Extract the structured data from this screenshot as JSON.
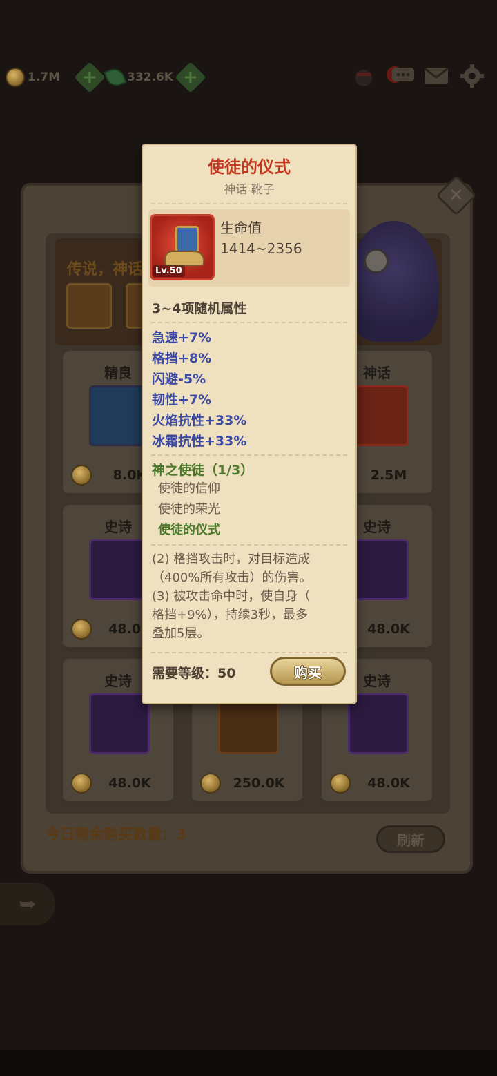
{
  "top_bar": {
    "gold": "1.7M",
    "gems": "332.6K",
    "notification_badge": "!"
  },
  "shop": {
    "banner_text": "传说，神话",
    "cards": [
      {
        "tier": "精良",
        "price": "8.0K"
      },
      {
        "tier": "神话",
        "price": "2.5M"
      },
      {
        "tier": "史诗",
        "price": "48.0K"
      },
      {
        "tier": "史诗",
        "price": "48.0K"
      },
      {
        "tier": "史诗",
        "price": "48.0K"
      },
      {
        "tier": "",
        "price": "250.0K"
      },
      {
        "tier": "史诗",
        "price": "48.0K"
      }
    ],
    "remaining_label": "今日剩余购买数量：3",
    "refresh_label": "刷新",
    "close_glyph": "✕"
  },
  "tooltip": {
    "title": "使徒的仪式",
    "subtitle": "神话 靴子",
    "level_tag": "Lv.50",
    "stat_name": "生命值",
    "stat_value": "1414~2356",
    "random_header": "3~4项随机属性",
    "attributes": [
      "急速+7%",
      "格挡+8%",
      "闪避-5%",
      "韧性+7%",
      "火焰抗性+33%",
      "冰霜抗性+33%"
    ],
    "set_name": "神之使徒（1/3）",
    "set_items": [
      "使徒的信仰",
      "使徒的荣光",
      "使徒的仪式"
    ],
    "description_lines": [
      "(2) 格挡攻击时，对目标造成",
      "（400%所有攻击）的伤害。",
      "(3) 被攻击命中时，使自身（",
      "格挡+9%），持续3秒，最多",
      "叠加5层。"
    ],
    "required_level": "需要等级：50",
    "buy_label": "购买"
  },
  "colors": {
    "title": "#c43a21",
    "attribute": "#3c4aa3",
    "set": "#4a7a2a",
    "parchment": "#efe0bf"
  }
}
